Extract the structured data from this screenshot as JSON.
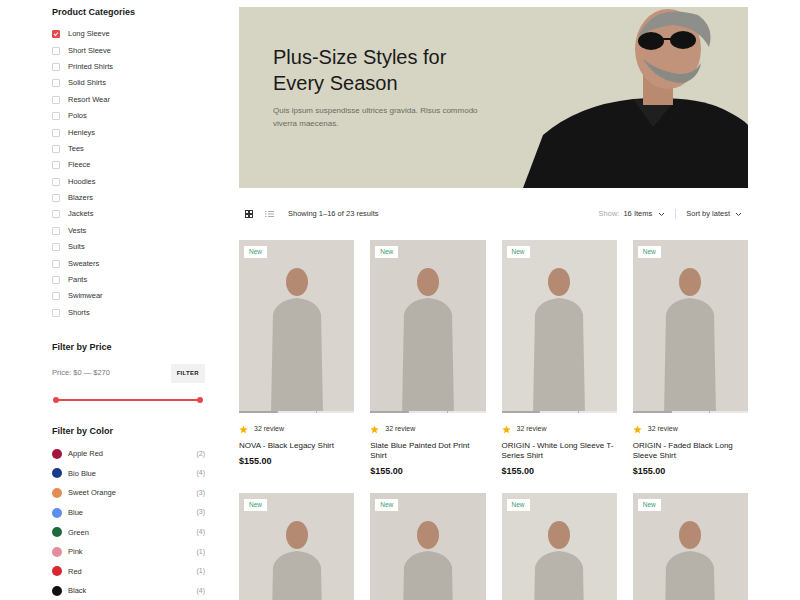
{
  "sidebar": {
    "categories_title": "Product Categories",
    "categories": [
      {
        "label": "Long Sleeve",
        "checked": true
      },
      {
        "label": "Short Sleeve",
        "checked": false
      },
      {
        "label": "Printed Shirts",
        "checked": false
      },
      {
        "label": "Solid Shirts",
        "checked": false
      },
      {
        "label": "Resort Wear",
        "checked": false
      },
      {
        "label": "Polos",
        "checked": false
      },
      {
        "label": "Henleys",
        "checked": false
      },
      {
        "label": "Tees",
        "checked": false
      },
      {
        "label": "Fleece",
        "checked": false
      },
      {
        "label": "Hoodies",
        "checked": false
      },
      {
        "label": "Blazers",
        "checked": false
      },
      {
        "label": "Jackets",
        "checked": false
      },
      {
        "label": "Vests",
        "checked": false
      },
      {
        "label": "Suits",
        "checked": false
      },
      {
        "label": "Sweaters",
        "checked": false
      },
      {
        "label": "Pants",
        "checked": false
      },
      {
        "label": "Swimwear",
        "checked": false
      },
      {
        "label": "Shorts",
        "checked": false
      }
    ],
    "price_title": "Filter by Price",
    "price_label": "Price: $0 — $270",
    "filter_button": "FILTER",
    "price_range": {
      "low": 0,
      "high": 1
    },
    "color_title": "Filter by Color",
    "colors": [
      {
        "label": "Apple Red",
        "count": "(2)",
        "color": "#a3163a"
      },
      {
        "label": "Bio Blue",
        "count": "(4)",
        "color": "#163a8c"
      },
      {
        "label": "Sweet Orange",
        "count": "(3)",
        "color": "#e38d55"
      },
      {
        "label": "Blue",
        "count": "(3)",
        "color": "#5e8df0"
      },
      {
        "label": "Green",
        "count": "(4)",
        "color": "#1d6a3b"
      },
      {
        "label": "Pink",
        "count": "(1)",
        "color": "#e58d9a"
      },
      {
        "label": "Red",
        "count": "(1)",
        "color": "#d9262f"
      },
      {
        "label": "Black",
        "count": "(4)",
        "color": "#111111"
      }
    ]
  },
  "banner": {
    "title": "Plus-Size Styles for Every Season",
    "text": "Quis ipsum suspendisse ultrices gravida. Risus commodo viverra maecenas."
  },
  "toolbar": {
    "views": [
      {
        "kind": "grid",
        "selected": true
      },
      {
        "kind": "list",
        "selected": false
      }
    ],
    "results": "Showing 1–16 of 23 results",
    "show_label": "Show:",
    "show_value": "16 Items",
    "sort": "Sort by latest"
  },
  "products": [
    {
      "badge": "New",
      "slides": [
        {
          "selected": true
        },
        {
          "selected": false
        },
        {
          "selected": false
        }
      ],
      "stars": 1,
      "reviews": "32 review",
      "name": "NOVA - Black Legacy Shirt",
      "price": "$155.00"
    },
    {
      "badge": "New",
      "slides": [
        {
          "selected": true
        },
        {
          "selected": false
        },
        {
          "selected": false
        }
      ],
      "stars": 1,
      "reviews": "32 review",
      "name": "Slate Blue Painted Dot Print Shirt",
      "price": "$155.00"
    },
    {
      "badge": "New",
      "slides": [
        {
          "selected": true
        },
        {
          "selected": false
        },
        {
          "selected": false
        }
      ],
      "stars": 1,
      "reviews": "32 review",
      "name": "ORIGIN - White Long Sleeve T-Series Shirt",
      "price": "$155.00"
    },
    {
      "badge": "New",
      "slides": [
        {
          "selected": true
        },
        {
          "selected": false
        },
        {
          "selected": false
        }
      ],
      "stars": 1,
      "reviews": "32 review",
      "name": "ORIGIN - Faded Black Long Sleeve Shirt",
      "price": "$155.00"
    },
    {
      "badge": "New"
    },
    {
      "badge": "New"
    },
    {
      "badge": "New"
    },
    {
      "badge": "New"
    }
  ]
}
